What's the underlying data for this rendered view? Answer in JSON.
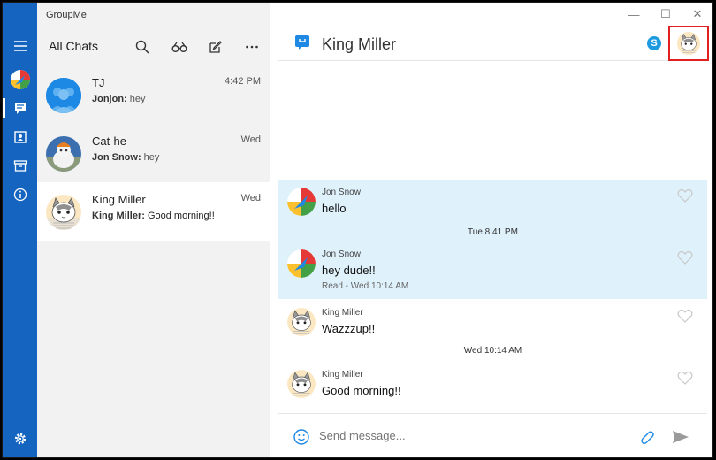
{
  "app": {
    "title": "GroupMe"
  },
  "rail": {
    "icons": [
      "hamburger-icon",
      "groupme-logo-icon",
      "chats-icon",
      "contacts-icon",
      "archive-icon",
      "info-icon",
      "settings-icon"
    ]
  },
  "list": {
    "header": "All Chats",
    "actions": [
      "search-icon",
      "binoculars-icon",
      "compose-icon",
      "more-icon"
    ],
    "chats": [
      {
        "name": "TJ",
        "time": "4:42 PM",
        "sender": "Jonjon:",
        "text": " hey",
        "avatar": "group-avatar"
      },
      {
        "name": "Cat-he",
        "time": "Wed",
        "sender": "Jon Snow:",
        "text": " hey",
        "avatar": "cat-photo-avatar"
      },
      {
        "name": "King Miller",
        "time": "Wed",
        "sender": "King Miller:",
        "text": " Good morning!!",
        "avatar": "cat-cartoon-avatar"
      }
    ]
  },
  "conversation": {
    "title": "King Miller",
    "window_controls": [
      "—",
      "☐",
      "✕"
    ],
    "messages": [
      {
        "sender": "Jon Snow",
        "text": "hello",
        "meta": ""
      },
      {
        "sender": "Jon Snow",
        "text": "hey dude!!",
        "meta": "Read - Wed 10:14 AM"
      },
      {
        "sender": "King Miller",
        "text": "Wazzzup!!",
        "meta": ""
      },
      {
        "sender": "King Miller",
        "text": "Good morning!!",
        "meta": ""
      }
    ],
    "timestamps": [
      "Tue 8:41 PM",
      "Wed 10:14 AM"
    ],
    "composer": {
      "placeholder": "Send message..."
    }
  },
  "colors": {
    "rail": "#1565c0",
    "highlight": "#dff1fb",
    "accent": "#1e88e5",
    "annotation_box": "#e02020"
  }
}
